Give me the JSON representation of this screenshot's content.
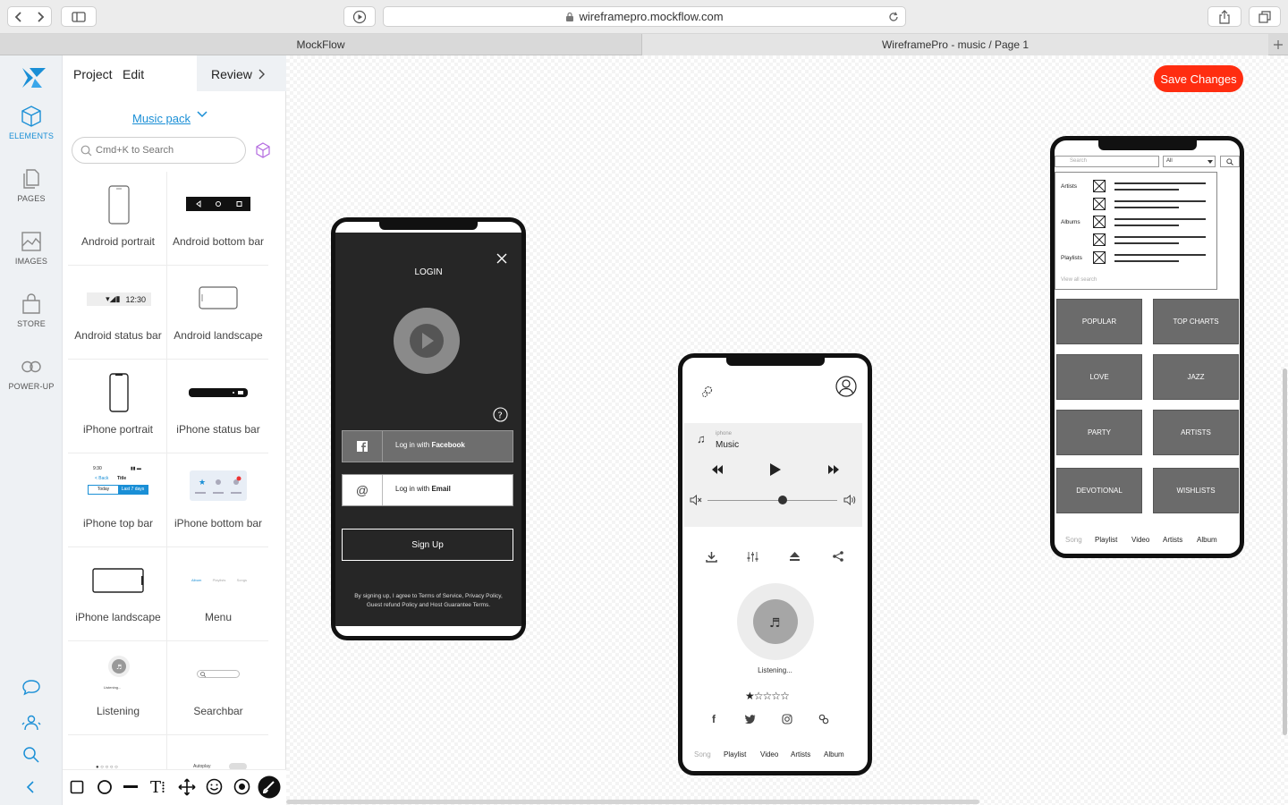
{
  "browser": {
    "url": "wireframepro.mockflow.com",
    "tabs": [
      {
        "label": "MockFlow"
      },
      {
        "label": "WireframePro - music / Page 1"
      }
    ]
  },
  "rail": {
    "items": [
      {
        "label": "ELEMENTS"
      },
      {
        "label": "PAGES"
      },
      {
        "label": "IMAGES"
      },
      {
        "label": "STORE"
      },
      {
        "label": "POWER-UP"
      }
    ]
  },
  "panel": {
    "menu": {
      "project": "Project",
      "edit": "Edit",
      "review": "Review"
    },
    "pack": "Music pack",
    "search_placeholder": "Cmd+K to Search",
    "elements": [
      {
        "label": "Android portrait"
      },
      {
        "label": "Android bottom bar"
      },
      {
        "label": "Android status bar",
        "time": "12:30"
      },
      {
        "label": "Android landscape"
      },
      {
        "label": "iPhone portrait"
      },
      {
        "label": "iPhone status bar"
      },
      {
        "label": "iPhone top bar",
        "time": "9:30",
        "back": "< Back",
        "title": "Title",
        "seg1": "Today",
        "seg2": "Last 7 days"
      },
      {
        "label": "iPhone bottom bar"
      },
      {
        "label": "iPhone landscape"
      },
      {
        "label": "Menu",
        "items": [
          "Album",
          "Playlists",
          "Songs"
        ]
      },
      {
        "label": "Listening",
        "sub": "Listening..."
      },
      {
        "label": "Searchbar"
      }
    ],
    "partial_label": "Autoplay"
  },
  "canvas": {
    "save_button": "Save Changes",
    "login": {
      "title": "LOGIN",
      "facebook_prefix": "Log in with ",
      "facebook_brand": "Facebook",
      "email_prefix": "Log in with ",
      "email_brand": "Email",
      "signup": "Sign Up",
      "terms_line1": "By signing up, I agree to  Terms of Service, Privacy Policy,",
      "terms_line2": "Guest refund Policy and Host Guarantee Terms."
    },
    "player": {
      "source": "iphone",
      "track": "Music",
      "listening": "Listening...",
      "rating": 1,
      "rating_max": 5,
      "volume": 0.58,
      "nav": [
        "Song",
        "Playlist",
        "Video",
        "Artists",
        "Album"
      ]
    },
    "search": {
      "placeholder": "Search",
      "filter": "All",
      "groups": [
        "Artists",
        "Albums",
        "Playlists"
      ],
      "view_all": "View all search",
      "tiles": [
        "POPULAR",
        "TOP CHARTS",
        "LOVE",
        "JAZZ",
        "PARTY",
        "ARTISTS",
        "DEVOTIONAL",
        "WISHLISTS"
      ],
      "nav": [
        "Song",
        "Playlist",
        "Video",
        "Artists",
        "Album"
      ]
    }
  },
  "colors": {
    "accent": "#1a8fd6",
    "save": "#ff2d10",
    "dark": "#262626",
    "tile": "#6b6b6b"
  }
}
